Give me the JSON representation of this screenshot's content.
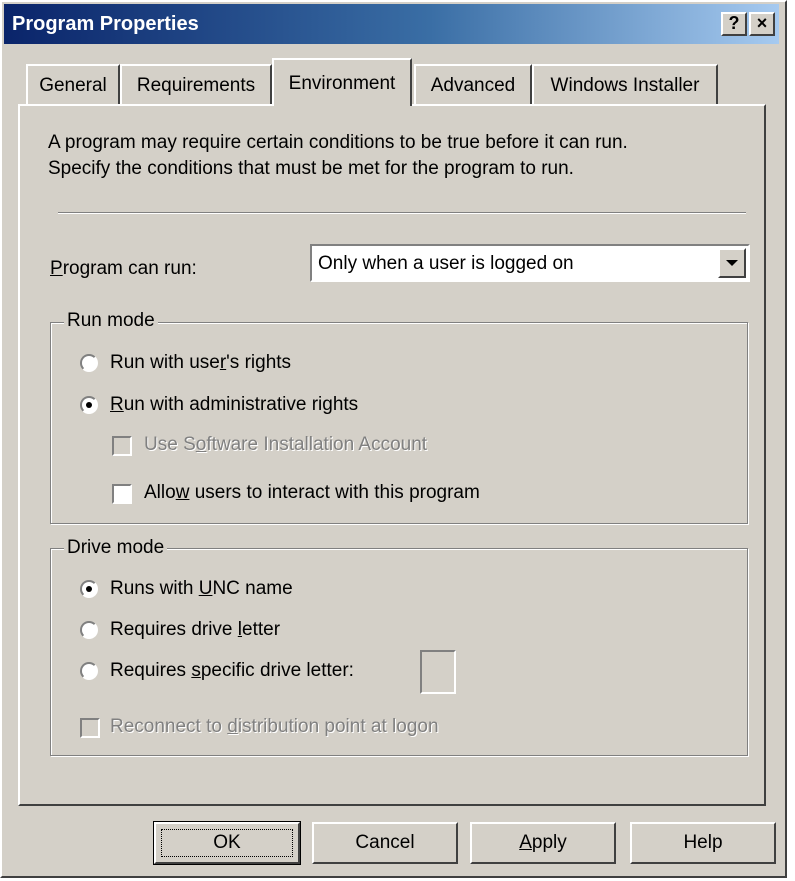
{
  "window": {
    "title": "Program Properties",
    "help_button": "?",
    "close_button": "×"
  },
  "tabs": [
    {
      "label": "General",
      "active": false
    },
    {
      "label": "Requirements",
      "active": false
    },
    {
      "label": "Environment",
      "active": true
    },
    {
      "label": "Advanced",
      "active": false
    },
    {
      "label": "Windows Installer",
      "active": false
    }
  ],
  "description": {
    "line1": "A program may require certain conditions to be true before it can run.",
    "line2": "Specify the conditions that must be met for the program to run."
  },
  "program_can_run": {
    "label_mnemonic": "P",
    "label_rest": "rogram can run:",
    "selected_value": "Only when a user is logged on"
  },
  "run_mode": {
    "legend": "Run mode",
    "user_rights": {
      "pre": "Run with use",
      "mnemonic": "r",
      "post": "'s rights",
      "checked": false
    },
    "admin_rights": {
      "pre": "",
      "mnemonic": "R",
      "post": "un with administrative rights",
      "checked": true
    },
    "software_account": {
      "pre": "Use S",
      "mnemonic": "o",
      "post": "ftware Installation Account",
      "checked": false,
      "enabled": false
    },
    "allow_interact": {
      "pre": "Allo",
      "mnemonic": "w",
      "post": " users to interact with this program",
      "checked": false,
      "enabled": true
    }
  },
  "drive_mode": {
    "legend": "Drive mode",
    "unc_name": {
      "pre": "Runs with ",
      "mnemonic": "U",
      "post": "NC name",
      "checked": true
    },
    "drive_letter": {
      "pre": "Requires drive ",
      "mnemonic": "l",
      "post": "etter",
      "checked": false
    },
    "specific_letter": {
      "pre": "Requires ",
      "mnemonic": "s",
      "post": "pecific drive letter:",
      "checked": false
    },
    "reconnect": {
      "pre": "Reconnect to ",
      "mnemonic": "d",
      "post": "istribution point at logon",
      "checked": false,
      "enabled": false
    }
  },
  "buttons": {
    "ok": "OK",
    "cancel": "Cancel",
    "apply_mnemonic": "A",
    "apply_rest": "pply",
    "help": "Help"
  }
}
